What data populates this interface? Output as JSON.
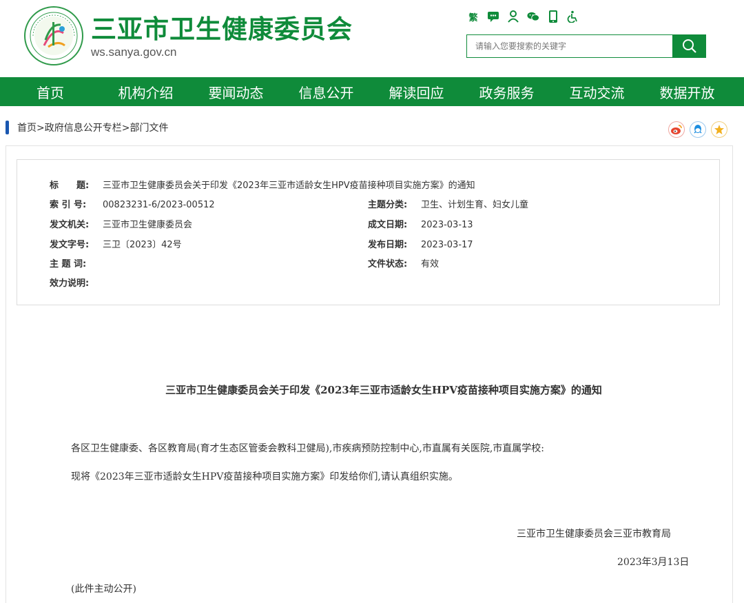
{
  "header": {
    "title": "三亚市卫生健康委员会",
    "url": "ws.sanya.gov.cn",
    "logo_icon": "sanya-health-commission-logo",
    "top_icons": [
      {
        "name": "traditional-chinese-toggle",
        "label": "繁"
      },
      {
        "name": "message-icon"
      },
      {
        "name": "user-icon"
      },
      {
        "name": "wechat-icon"
      },
      {
        "name": "mobile-icon"
      },
      {
        "name": "accessibility-icon"
      }
    ],
    "search_placeholder": "请输入您要搜索的关键字",
    "search_icon": "search-icon"
  },
  "nav": {
    "items": [
      "首页",
      "机构介绍",
      "要闻动态",
      "信息公开",
      "解读回应",
      "政务服务",
      "互动交流",
      "数据开放"
    ]
  },
  "breadcrumb": {
    "items": [
      "首页",
      "政府信息公开专栏",
      "部门文件"
    ],
    "separator": ">"
  },
  "share_icons": [
    "weibo-icon",
    "qq-icon",
    "favorite-icon"
  ],
  "meta": {
    "title_label": "标　　题:",
    "title_value": "三亚市卫生健康委员会关于印发《2023年三亚市适龄女生HPV疫苗接种项目实施方案》的通知",
    "index_label": "索 引 号:",
    "index_value": "00823231-6/2023-00512",
    "topic_label": "主题分类:",
    "topic_value": "卫生、计划生育、妇女儿童",
    "issuer_label": "发文机关:",
    "issuer_value": "三亚市卫生健康委员会",
    "created_label": "成文日期:",
    "created_value": "2023-03-13",
    "docno_label": "发文字号:",
    "docno_value": "三卫〔2023〕42号",
    "published_label": "发布日期:",
    "published_value": "2023-03-17",
    "keywords_label": "主 题 词:",
    "keywords_value": "",
    "status_label": "文件状态:",
    "status_value": "有效",
    "validity_label": "效力说明:",
    "validity_value": ""
  },
  "document": {
    "title": "三亚市卫生健康委员会关于印发《2023年三亚市适龄女生HPV疫苗接种项目实施方案》的通知",
    "recipients": "各区卫生健康委、各区教育局(育才生态区管委会教科卫健局),市疾病预防控制中心,市直属有关医院,市直属学校:",
    "body": "现将《2023年三亚市适龄女生HPV疫苗接种项目实施方案》印发给你们,请认真组织实施。",
    "signature": "三亚市卫生健康委员会三亚市教育局",
    "date": "2023年3月13日",
    "note": "(此件主动公开)"
  },
  "colors": {
    "brand_green": "#0f8b3a",
    "breadcrumb_marker": "#1a57b0"
  }
}
